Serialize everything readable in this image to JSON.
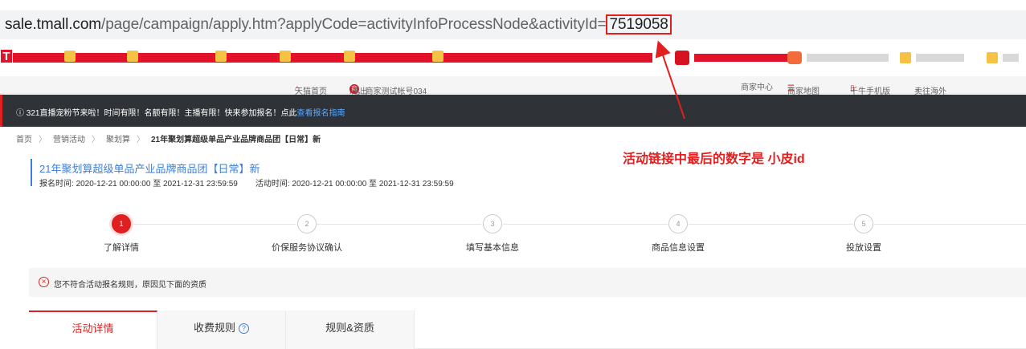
{
  "browser": {
    "url_host": "sale.tmall.com",
    "url_path": "/page/campaign/apply.htm?applyCode=activityInfoProcessNode&activityId=",
    "url_activity_id": "7519058"
  },
  "site_top": {
    "home": "天猫首页",
    "greeting": "Hi，商家测试帐号034",
    "badge": "商",
    "logout": "退出",
    "merchant_center": "商家中心",
    "merchant_map": "商家地图",
    "qianniu": "千牛手机版",
    "overseas": "卖往海外"
  },
  "announcement": {
    "text": "321直播宠粉节来啦！时间有限！名额有限！主播有限！快来参加报名！点此",
    "link": "查看报名指南"
  },
  "breadcrumb": [
    "首页",
    "营销活动",
    "聚划算",
    "21年聚划算超级单品产业品牌商品团【日常】新"
  ],
  "activity": {
    "title": "21年聚划算超级单品产业品牌商品团【日常】新",
    "signup_label": "报名时间:",
    "signup_time": "2020-12-21 00:00:00 至 2021-12-31 23:59:59",
    "activity_label": "活动时间:",
    "activity_time": "2020-12-21 00:00:00 至 2021-12-31 23:59:59"
  },
  "annotation": "活动链接中最后的数字是 小皮id",
  "steps": [
    {
      "num": "1",
      "label": "了解详情",
      "active": true
    },
    {
      "num": "2",
      "label": "价保服务协议确认",
      "active": false
    },
    {
      "num": "3",
      "label": "填写基本信息",
      "active": false
    },
    {
      "num": "4",
      "label": "商品信息设置",
      "active": false
    },
    {
      "num": "5",
      "label": "投放设置",
      "active": false
    }
  ],
  "warning": "您不符合活动报名规则，原因见下面的资质",
  "tabs": [
    {
      "label": "活动详情",
      "active": true
    },
    {
      "label": "收费规则",
      "active": false,
      "help": "?"
    },
    {
      "label": "规则&资质",
      "active": false
    }
  ],
  "colors": {
    "accent": "#e02020",
    "link": "#3e7fd6",
    "dark_bar": "#2f3237"
  }
}
